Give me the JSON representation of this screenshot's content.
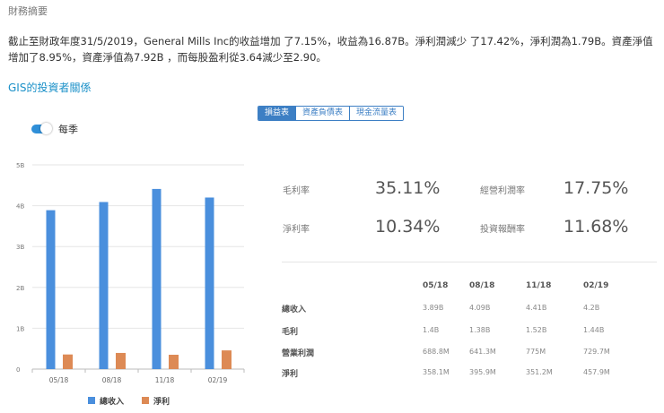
{
  "section_header": "財務摘要",
  "summary": "截止至財政年度31/5/2019，General Mills Inc的收益增加 了7.15%，收益為16.87B。淨利潤減少 了17.42%，淨利潤為1.79B。資產淨值增加了8.95%，資產淨值為7.92B ，而每股盈利從3.64減少至2.90。",
  "investor_title": "GIS的投資者關係",
  "tabs": [
    {
      "label": "損益表",
      "active": true
    },
    {
      "label": "資產負債表",
      "active": false
    },
    {
      "label": "現金流量表",
      "active": false
    }
  ],
  "toggle": {
    "label": "每季",
    "on": true
  },
  "ratios": {
    "gross_margin": {
      "label": "毛利率",
      "value": "35.11%"
    },
    "operating_margin": {
      "label": "經營利潤率",
      "value": "17.75%"
    },
    "net_margin": {
      "label": "淨利率",
      "value": "10.34%"
    },
    "roi": {
      "label": "投資報酬率",
      "value": "11.68%"
    }
  },
  "table": {
    "columns": [
      "05/18",
      "08/18",
      "11/18",
      "02/19"
    ],
    "rows": [
      {
        "label": "總收入",
        "values": [
          "3.89B",
          "4.09B",
          "4.41B",
          "4.2B"
        ]
      },
      {
        "label": "毛利",
        "values": [
          "1.4B",
          "1.38B",
          "1.52B",
          "1.44B"
        ]
      },
      {
        "label": "營業利潤",
        "values": [
          "688.8M",
          "641.3M",
          "775M",
          "729.7M"
        ]
      },
      {
        "label": "淨利",
        "values": [
          "358.1M",
          "395.9M",
          "351.2M",
          "457.9M"
        ]
      }
    ]
  },
  "chart_data": {
    "type": "bar",
    "categories": [
      "05/18",
      "08/18",
      "11/18",
      "02/19"
    ],
    "series": [
      {
        "name": "總收入",
        "values": [
          3.89,
          4.09,
          4.41,
          4.2
        ],
        "color": "#4a8fdd"
      },
      {
        "name": "淨利",
        "values": [
          0.3581,
          0.3959,
          0.3512,
          0.4579
        ],
        "color": "#dd8a55"
      }
    ],
    "yticks": [
      "0",
      "1B",
      "2B",
      "3B",
      "4B",
      "5B"
    ],
    "ylim": [
      0,
      5
    ],
    "grid": true,
    "legend": "bottom"
  }
}
